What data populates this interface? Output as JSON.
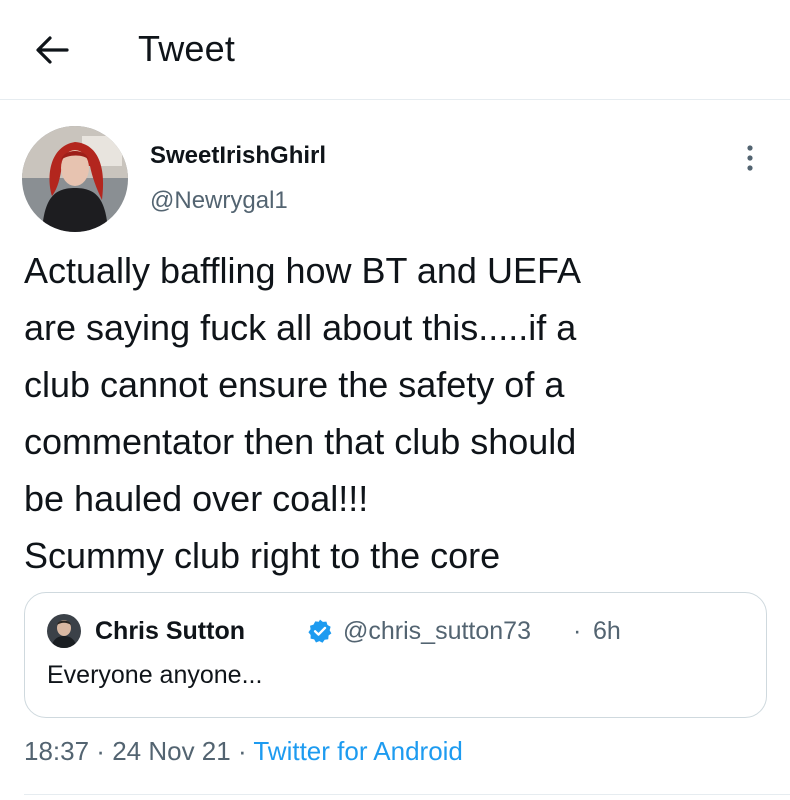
{
  "header": {
    "title": "Tweet",
    "back_icon": "arrow-left-icon"
  },
  "tweet": {
    "author": {
      "display_name": "SweetIrishGhirl",
      "handle": "@Newrygal1"
    },
    "text": "Actually baffling how BT and UEFA\nare saying fuck all about this.....if a\nclub cannot ensure the safety of a\ncommentator then that club should\nbe hauled over coal!!!\nScummy club right to the core",
    "more_icon": "more-vertical-icon",
    "quoted": {
      "display_name": "Chris Sutton",
      "verified_icon": "verified-badge-icon",
      "handle": "@chris_sutton73",
      "separator": "·",
      "time": "6h",
      "text": "Everyone anyone..."
    },
    "meta": {
      "time": "18:37",
      "sep1": " · ",
      "date": "24 Nov 21",
      "sep2": " · ",
      "source": "Twitter for Android"
    }
  },
  "colors": {
    "text": "#0f1419",
    "secondary": "#536471",
    "accent": "#1d9bf0",
    "border": "#cfd9de"
  }
}
